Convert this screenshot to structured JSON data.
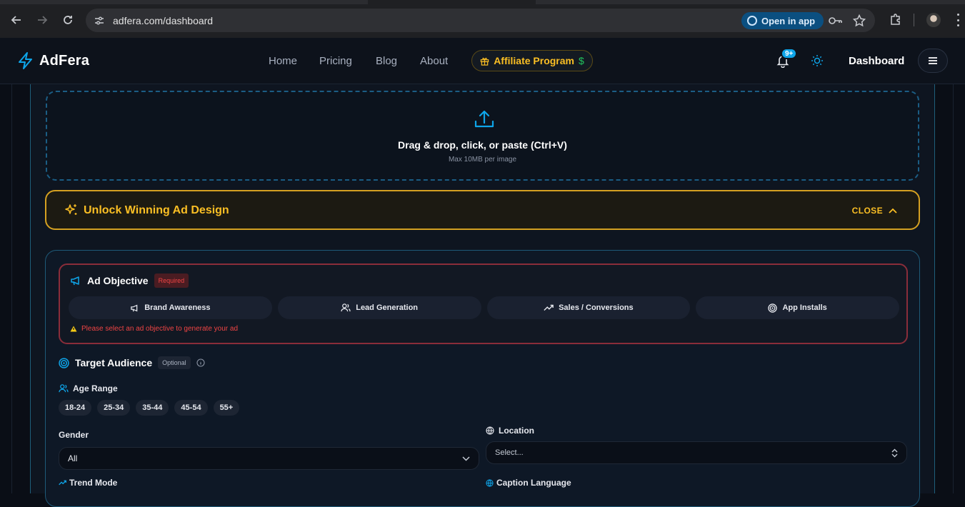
{
  "browser": {
    "url": "adfera.com/dashboard",
    "open_in_app_label": "Open in app"
  },
  "header": {
    "brand": "AdFera",
    "nav": [
      "Home",
      "Pricing",
      "Blog",
      "About"
    ],
    "affiliate_label": "Affiliate Program",
    "affiliate_currency": "$",
    "notifications_badge": "9+",
    "dashboard_label": "Dashboard"
  },
  "upload": {
    "title": "Drag & drop, click, or paste (Ctrl+V)",
    "subtitle": "Max 10MB per image"
  },
  "unlock": {
    "title": "Unlock Winning Ad Design",
    "close_label": "CLOSE"
  },
  "objective": {
    "title": "Ad Objective",
    "required_label": "Required",
    "options": [
      "Brand Awareness",
      "Lead Generation",
      "Sales / Conversions",
      "App Installs"
    ],
    "warning": "Please select an ad objective to generate your ad"
  },
  "audience": {
    "title": "Target Audience",
    "optional_label": "Optional",
    "age_label": "Age Range",
    "ages": [
      "18-24",
      "25-34",
      "35-44",
      "45-54",
      "55+"
    ],
    "gender_label": "Gender",
    "gender_value": "All",
    "location_label": "Location",
    "location_placeholder": "Select...",
    "trend_label": "Trend Mode",
    "caption_label": "Caption Language"
  },
  "colors": {
    "accent": "#0ea5e9",
    "gold": "#fbbf24",
    "error": "#ef4444"
  }
}
